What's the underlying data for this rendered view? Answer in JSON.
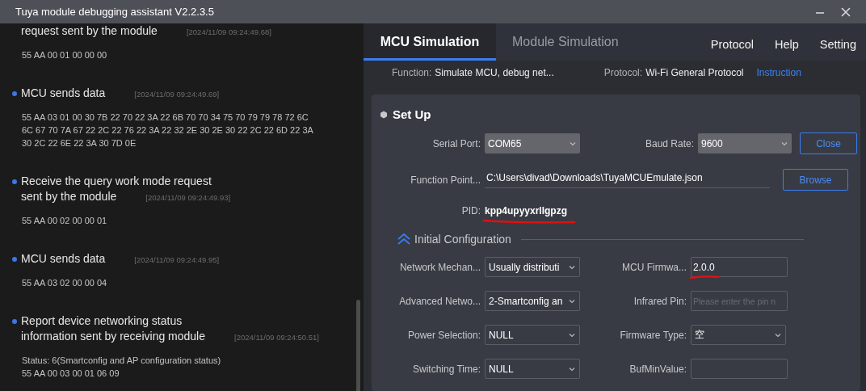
{
  "window": {
    "title": "Tuya module debugging assistant V2.2.3.5"
  },
  "log": [
    {
      "bullet": false,
      "title_lines": [
        "request sent by the module"
      ],
      "time": "[2024/11/09 09:24:49.68]",
      "lines": [
        "55 AA 00 01 00 00 00"
      ]
    },
    {
      "bullet": true,
      "title_lines": [
        "MCU sends data"
      ],
      "time": "[2024/11/09 09:24:49.69]",
      "lines": [
        "55 AA 03 01 00 30 7B 22 70 22 3A 22 6B 70 70 34 75 70 79 79 78 72 6C",
        "6C 67 70 7A 67 22 2C 22 76 22 3A 22 32 2E 30 2E 30 22 2C 22 6D 22 3A",
        "30 2C 22 6E 22 3A 30 7D 0E"
      ]
    },
    {
      "bullet": true,
      "title_lines": [
        "Receive the query work mode request",
        "sent by the module"
      ],
      "time": "[2024/11/09 09:24:49.93]",
      "lines": [
        "55 AA 00 02 00 00 01"
      ]
    },
    {
      "bullet": true,
      "title_lines": [
        "MCU sends data"
      ],
      "time": "[2024/11/09 09:24:49.95]",
      "lines": [
        "55 AA 03 02 00 00 04"
      ]
    },
    {
      "bullet": true,
      "title_lines": [
        "Report device networking status",
        "information sent by receiving module"
      ],
      "time": "[2024/11/09 09:24:50.51]",
      "lines": [
        "Status: 6(Smartconfig and AP configuration status)",
        "55 AA 00 03 00 01 06 09"
      ]
    }
  ],
  "tabs": [
    {
      "label": "MCU Simulation",
      "selected": true
    },
    {
      "label": "Module Simulation",
      "selected": false
    }
  ],
  "menu": [
    "Protocol",
    "Help",
    "Setting"
  ],
  "info": {
    "function_label": "Function:",
    "function_value": "Simulate MCU, debug net...",
    "protocol_label": "Protocol:",
    "protocol_value": "Wi-Fi General Protocol",
    "link": "Instruction"
  },
  "setup": {
    "title": "Set Up",
    "serial_port": {
      "label": "Serial Port:",
      "value": "COM65"
    },
    "baud_rate": {
      "label": "Baud Rate:",
      "value": "9600"
    },
    "close_button": "Close",
    "function_point": {
      "label": "Function Point...",
      "value": "C:\\Users\\divad\\Downloads\\TuyaMCUEmulate.json"
    },
    "browse_button": "Browse",
    "pid": {
      "label": "PID:",
      "value": "kpp4upyyxrllgpzg"
    },
    "initial_configuration": {
      "title": "Initial Configuration",
      "expanded": true,
      "fields": [
        {
          "kind": "select",
          "label": "Network Mechan...",
          "value": "Usually distributi"
        },
        {
          "kind": "input",
          "label": "MCU Firmwa...",
          "value": "2.0.0"
        },
        {
          "kind": "select",
          "label": "Advanced Netwo...",
          "value": "2-Smartconfig an"
        },
        {
          "kind": "input",
          "label": "Infrared Pin:",
          "placeholder": "Please enter the pin n"
        },
        {
          "kind": "select",
          "label": "Power Selection:",
          "value": "NULL"
        },
        {
          "kind": "select",
          "label": "Firmware Type:",
          "value": "空"
        },
        {
          "kind": "select",
          "label": "Switching Time:",
          "value": "NULL"
        },
        {
          "kind": "input",
          "label": "BufMinValue:"
        }
      ]
    }
  }
}
